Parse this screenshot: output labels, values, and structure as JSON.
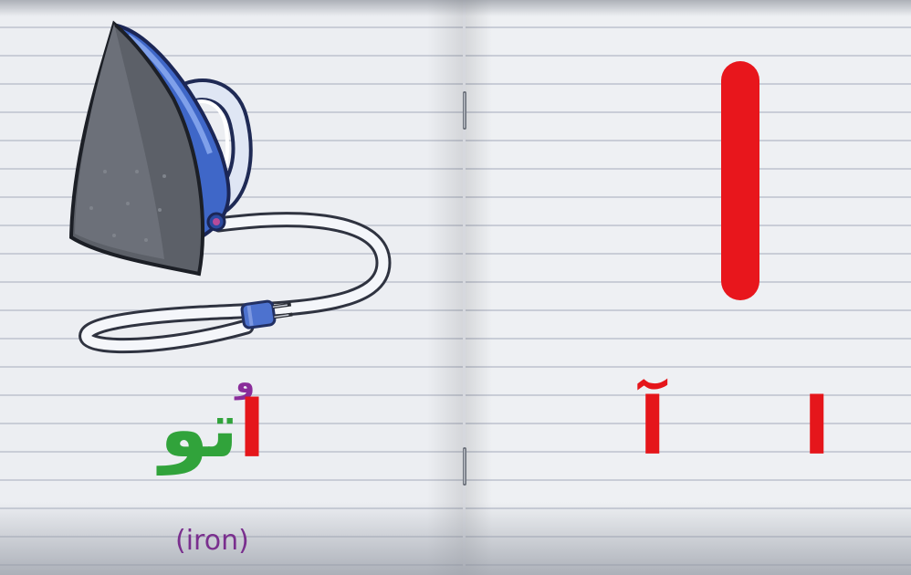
{
  "left_page": {
    "illustration": "clothes-iron",
    "word": {
      "alef": "ا",
      "rest": "تو",
      "vowel_mark": "و"
    },
    "caption": "(iron)"
  },
  "right_page": {
    "large_letter": "ا",
    "forms": {
      "alef": "ا",
      "alef_madda": "آ"
    }
  },
  "colors": {
    "letter_red": "#e5161b",
    "word_green": "#31a33b",
    "caption_purple": "#7a2f8e",
    "iron_blue": "#3b63c4"
  }
}
